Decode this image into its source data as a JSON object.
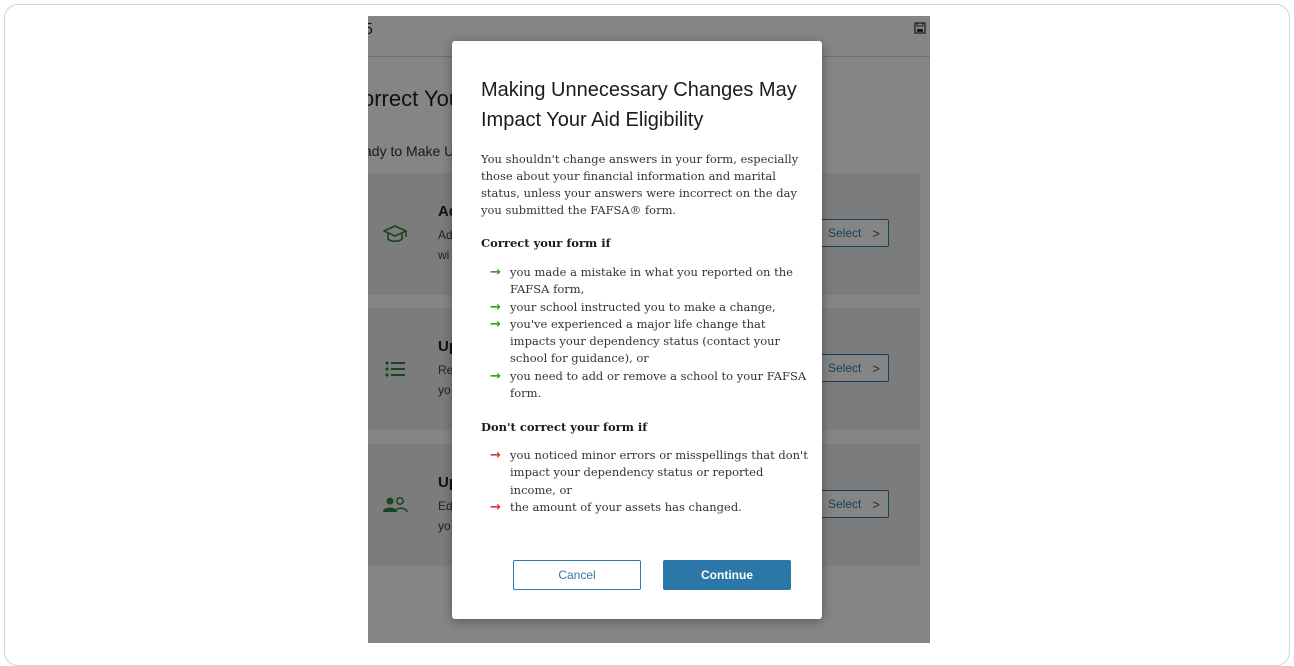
{
  "background": {
    "header_title": "5",
    "page_title": "orrect Your",
    "page_subtitle": "ady to Make Up",
    "cards": [
      {
        "title": "Ad",
        "desc_line1": "Ad",
        "desc_line2": "wi",
        "action_label": "Select",
        "icon": "graduation-cap-icon"
      },
      {
        "title": "Up",
        "desc_line1": "Re",
        "desc_line2": "yo",
        "action_label": "Select",
        "icon": "list-icon"
      },
      {
        "title": "Up",
        "desc_line1": "Ed",
        "desc_line2": "yo",
        "action_label": "Select",
        "icon": "users-icon"
      }
    ]
  },
  "modal": {
    "title": "Making Unnecessary Changes May Impact Your Aid Eligibility",
    "intro": "You shouldn't change answers in your form, especially those about your financial information and marital status, unless your answers were incorrect on the day you submitted the FAFSA® form.",
    "correct_heading": "Correct your form if",
    "correct_items": [
      "you made a mistake in what you reported on the FAFSA form,",
      "your school instructed you to make a change,",
      "you've experienced a major life change that impacts your dependency status (contact your school for guidance), or",
      "you need to add or remove a school to your FAFSA form."
    ],
    "dont_heading": "Don't correct your form if",
    "dont_items": [
      "you noticed minor errors or misspellings that don't impact your dependency status or reported income, or",
      "the amount of your assets has changed."
    ],
    "cancel_label": "Cancel",
    "continue_label": "Continue"
  },
  "colors": {
    "primary": "#2b77a8",
    "success_arrow": "#3a9d23",
    "danger_arrow": "#d83933",
    "icon_green": "#2e8540"
  }
}
